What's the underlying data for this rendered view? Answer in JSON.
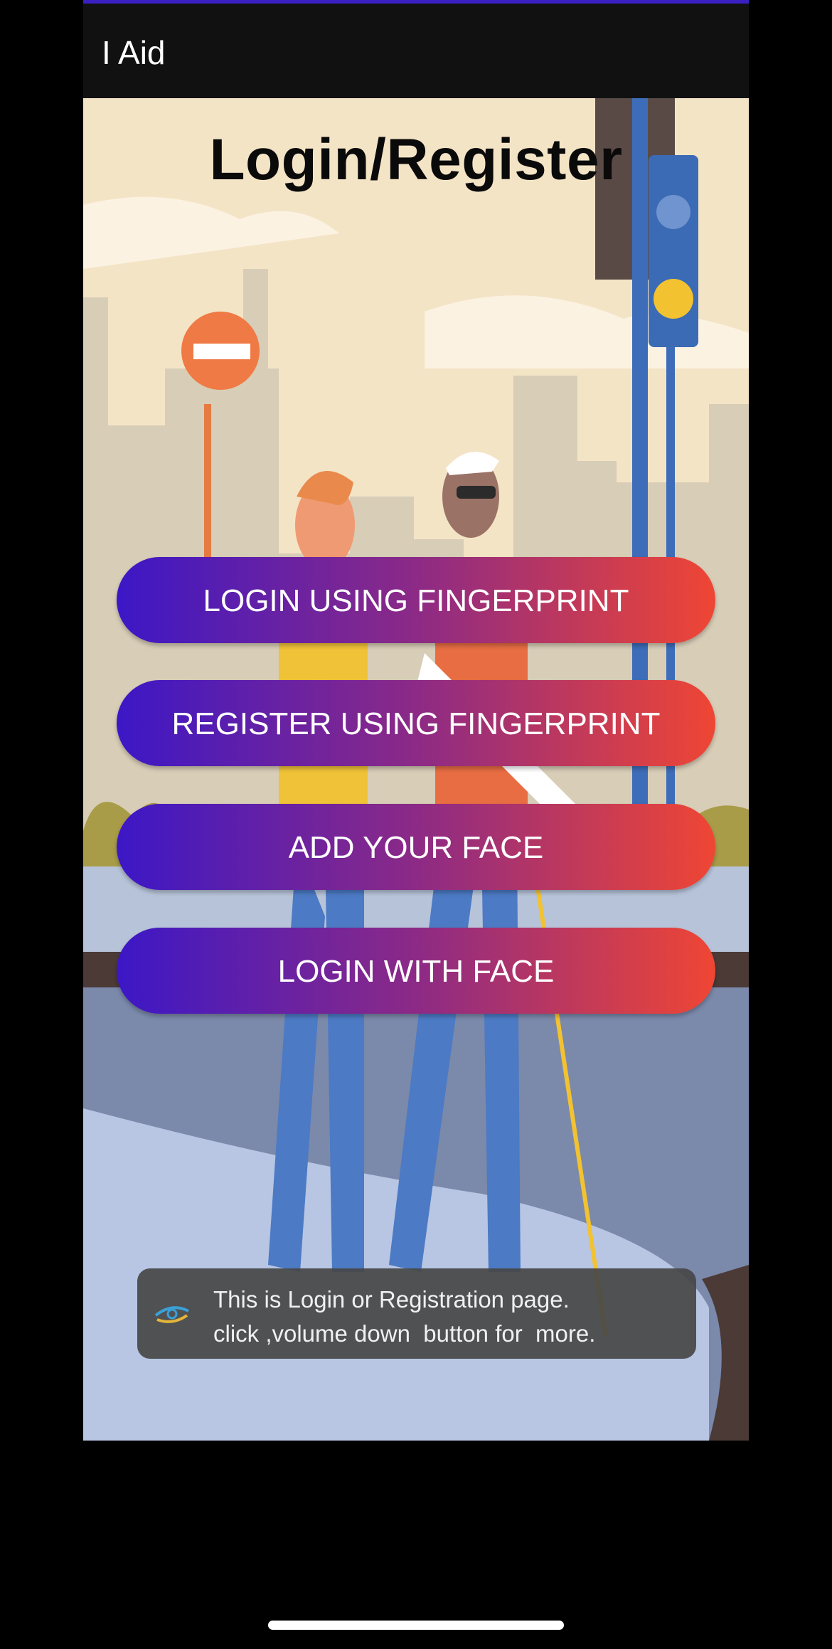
{
  "app": {
    "title": "I Aid"
  },
  "page": {
    "title": "Login/Register"
  },
  "buttons": {
    "login_fingerprint": "LOGIN USING FINGERPRINT",
    "register_fingerprint": "REGISTER USING FINGERPRINT",
    "add_face": "ADD YOUR FACE",
    "login_face": "LOGIN WITH FACE"
  },
  "toast": {
    "line1": "This is Login or Registration page.",
    "line2": "click ,volume down  button for  more.",
    "icon": "app-logo-icon"
  },
  "colors": {
    "button_gradient_start": "#3c17c6",
    "button_gradient_end": "#ef4634",
    "appbar": "#111111",
    "accent_line": "#3a1fc1"
  }
}
